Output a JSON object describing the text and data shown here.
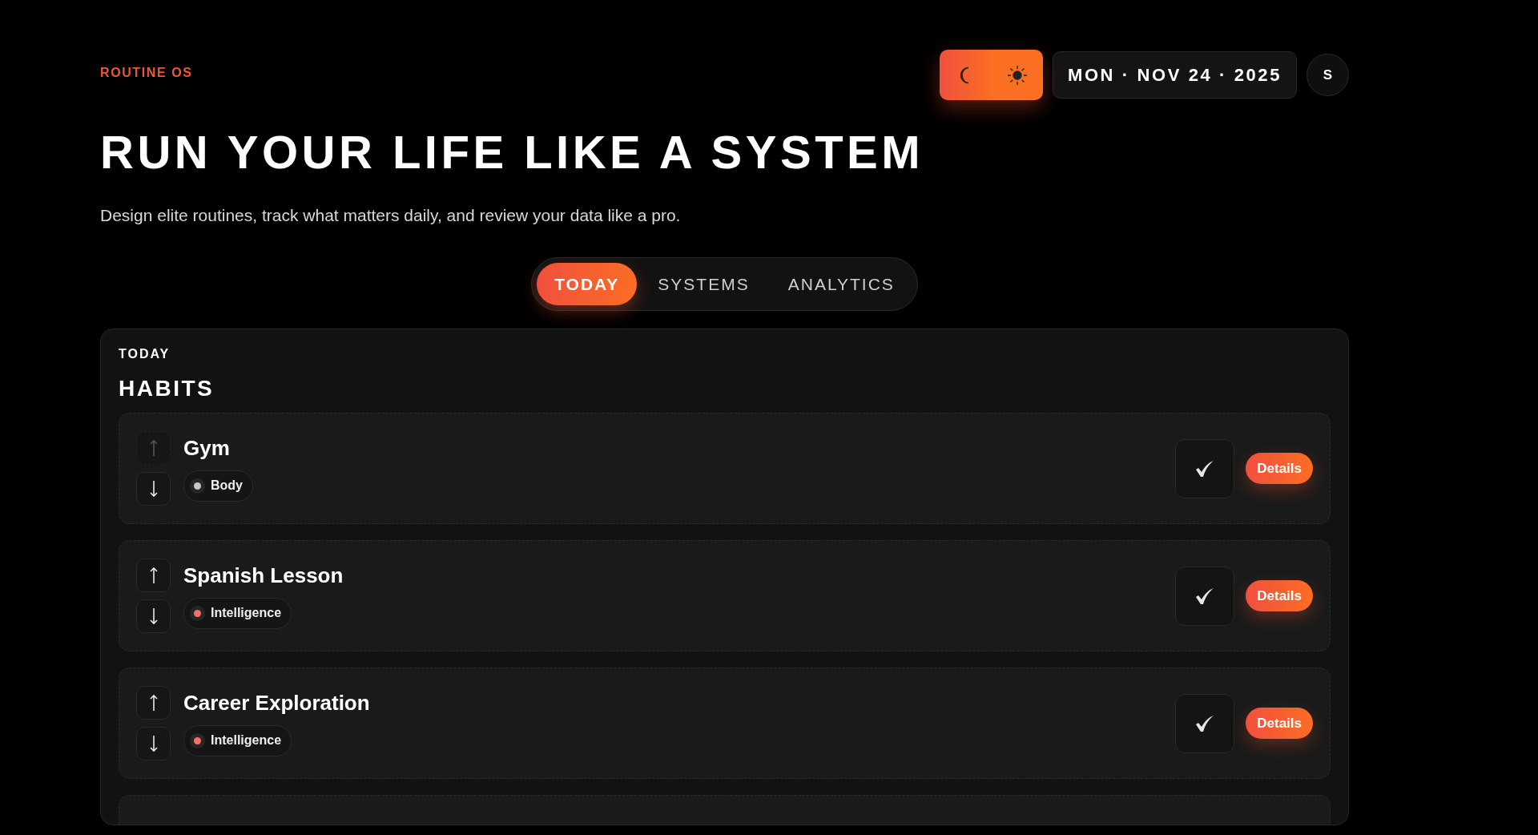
{
  "brand": "ROUTINE OS",
  "date": "MON · NOV 24 · 2025",
  "avatar": "S",
  "title": "RUN YOUR LIFE LIKE A SYSTEM",
  "subtitle": "Design elite routines, track what matters daily, and review your data like a pro.",
  "tabs": [
    {
      "label": "TODAY",
      "selected": true
    },
    {
      "label": "SYSTEMS",
      "selected": false
    },
    {
      "label": "ANALYTICS",
      "selected": false
    }
  ],
  "panel": {
    "eyebrow": "TODAY",
    "heading": "HABITS",
    "habits": [
      {
        "name": "Gym",
        "category": "Body",
        "color": "#c8c8c8",
        "up_disabled": true,
        "details": "Details"
      },
      {
        "name": "Spanish Lesson",
        "category": "Intelligence",
        "color": "#f0736a",
        "up_disabled": false,
        "details": "Details"
      },
      {
        "name": "Career Exploration",
        "category": "Intelligence",
        "color": "#f0736a",
        "up_disabled": false,
        "details": "Details"
      }
    ]
  }
}
